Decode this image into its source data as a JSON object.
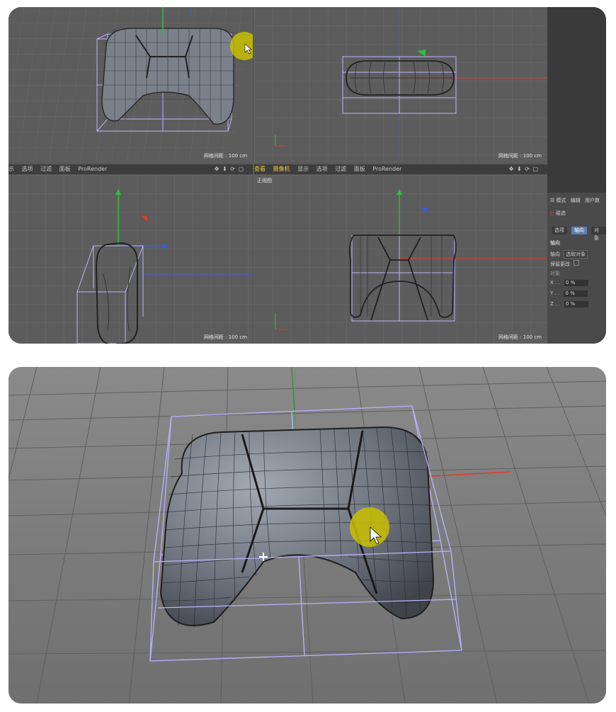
{
  "top": {
    "viewport_tl": {
      "grid_label": "网格间距 : 100 cm"
    },
    "viewport_tr": {
      "grid_label": "网格间距 : 100 cm"
    },
    "viewport_bl": {
      "menu": [
        "示",
        "选项",
        "过滤",
        "面板",
        "ProRender"
      ],
      "grid_label": "网格间距 : 100 cm"
    },
    "viewport_br": {
      "menu": [
        "查看",
        "摄像机",
        "显示",
        "选项",
        "过滤",
        "面板",
        "ProRender"
      ],
      "title": "正视图",
      "grid_label": "网格间距 : 100 cm"
    },
    "attributes": {
      "header": [
        "模式",
        "编辑",
        "用户数"
      ],
      "object_name": "碰选",
      "tabs": [
        "选项",
        "轴向",
        "对象"
      ],
      "section": "轴向",
      "axis_label": "轴向",
      "axis_button": "选取对象",
      "keep_label": "保留更改",
      "object_label": "对象",
      "coords": [
        {
          "axis": "X",
          "value": "0 %"
        },
        {
          "axis": "Y",
          "value": "0 %"
        },
        {
          "axis": "Z",
          "value": "0 %"
        }
      ]
    }
  },
  "colors": {
    "viewport_bg": "#5e5e5e",
    "mesh": "#6e7682",
    "cage": "#b9b3ff",
    "cursor_highlight": "#c9c000",
    "axis_x": "#e03a2a",
    "axis_y": "#2fbd3c",
    "axis_z": "#3a5be0"
  }
}
